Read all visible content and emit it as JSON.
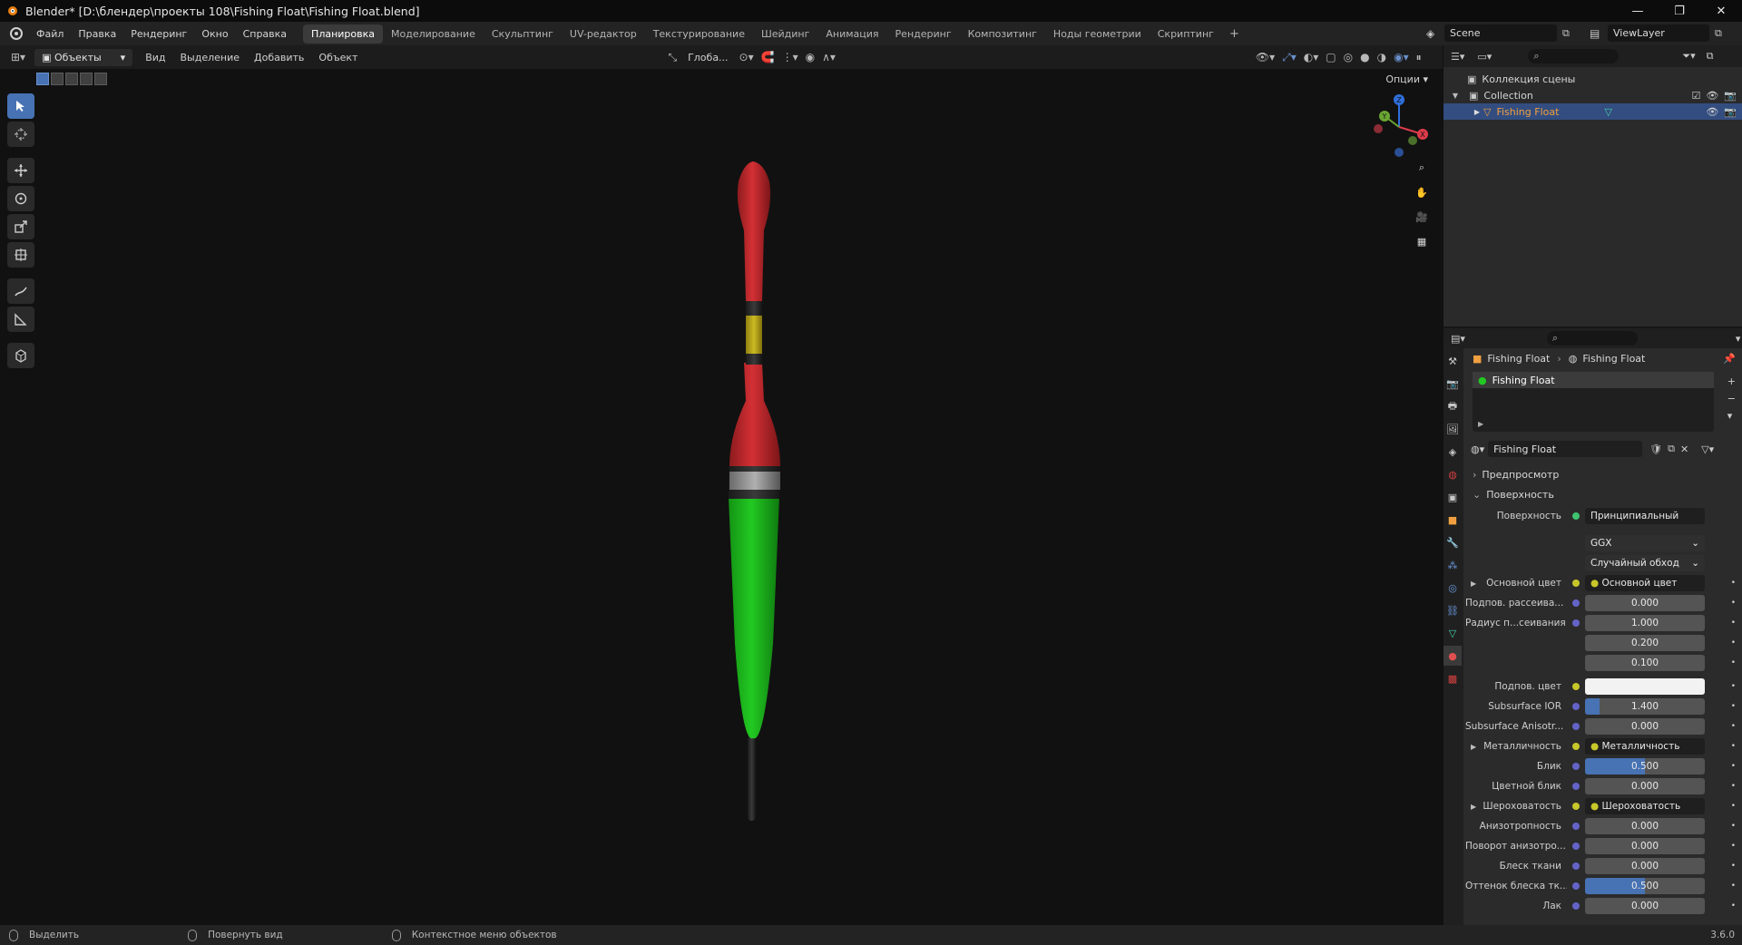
{
  "window": {
    "title": "Blender* [D:\\блендер\\проекты 108\\Fishing Float\\Fishing Float.blend]"
  },
  "menu": [
    "Файл",
    "Правка",
    "Рендеринг",
    "Окно",
    "Справка"
  ],
  "workspaces": [
    "Планировка",
    "Моделирование",
    "Скульптинг",
    "UV-редактор",
    "Текстурирование",
    "Шейдинг",
    "Анимация",
    "Рендеринг",
    "Композитинг",
    "Ноды геометрии",
    "Скриптинг"
  ],
  "active_workspace": "Планировка",
  "scene": "Scene",
  "view_layer": "ViewLayer",
  "viewport_header": {
    "mode": "Объекты",
    "menus": [
      "Вид",
      "Выделение",
      "Добавить",
      "Объект"
    ],
    "orientation": "Глоба...",
    "options": "Опции"
  },
  "outliner": {
    "scene_collection": "Коллекция сцены",
    "collection": "Collection",
    "object": "Fishing Float"
  },
  "properties": {
    "breadcrumb_object": "Fishing Float",
    "breadcrumb_material": "Fishing Float",
    "slot": "Fishing Float",
    "material_name": "Fishing Float",
    "preview_panel": "Предпросмотр",
    "surface_panel": "Поверхность",
    "surface_label": "Поверхность",
    "surface_shader": "Принципиальный BSDF",
    "distribution": "GGX",
    "subsurface_method": "Случайный обход",
    "rows": [
      {
        "label": "Основной цвет",
        "value": "Основной цвет",
        "type": "link"
      },
      {
        "label": "Подпов. рассеива...",
        "value": "0.000",
        "type": "num",
        "fill": 0
      },
      {
        "label": "Радиус п...сеивания",
        "value": "1.000",
        "type": "num",
        "fill": 0
      },
      {
        "label": "",
        "value": "0.200",
        "type": "num",
        "fill": 0
      },
      {
        "label": "",
        "value": "0.100",
        "type": "num",
        "fill": 0
      },
      {
        "label": "Подпов. цвет",
        "value": "",
        "type": "color"
      },
      {
        "label": "Subsurface IOR",
        "value": "1.400",
        "type": "num",
        "fill": 0.12
      },
      {
        "label": "Subsurface Anisotr...",
        "value": "0.000",
        "type": "num",
        "fill": 0
      },
      {
        "label": "Металличность",
        "value": "Металличность",
        "type": "link"
      },
      {
        "label": "Блик",
        "value": "0.500",
        "type": "num",
        "fill": 0.5
      },
      {
        "label": "Цветной блик",
        "value": "0.000",
        "type": "num",
        "fill": 0
      },
      {
        "label": "Шероховатость",
        "value": "Шероховатость",
        "type": "link"
      },
      {
        "label": "Анизотропность",
        "value": "0.000",
        "type": "num",
        "fill": 0
      },
      {
        "label": "Поворот анизотро...",
        "value": "0.000",
        "type": "num",
        "fill": 0
      },
      {
        "label": "Блеск ткани",
        "value": "0.000",
        "type": "num",
        "fill": 0
      },
      {
        "label": "Оттенок блеска тк...",
        "value": "0.500",
        "type": "num",
        "fill": 0.5
      },
      {
        "label": "Лак",
        "value": "0.000",
        "type": "num",
        "fill": 0
      }
    ]
  },
  "statusbar": {
    "select": "Выделить",
    "rotate": "Повернуть вид",
    "context": "Контекстное меню объектов",
    "version": "3.6.0"
  },
  "colors": {
    "accent": "#4772b3",
    "float_red": "#c0262b",
    "float_green": "#1fbf1f",
    "float_yellow": "#c8b61c"
  }
}
